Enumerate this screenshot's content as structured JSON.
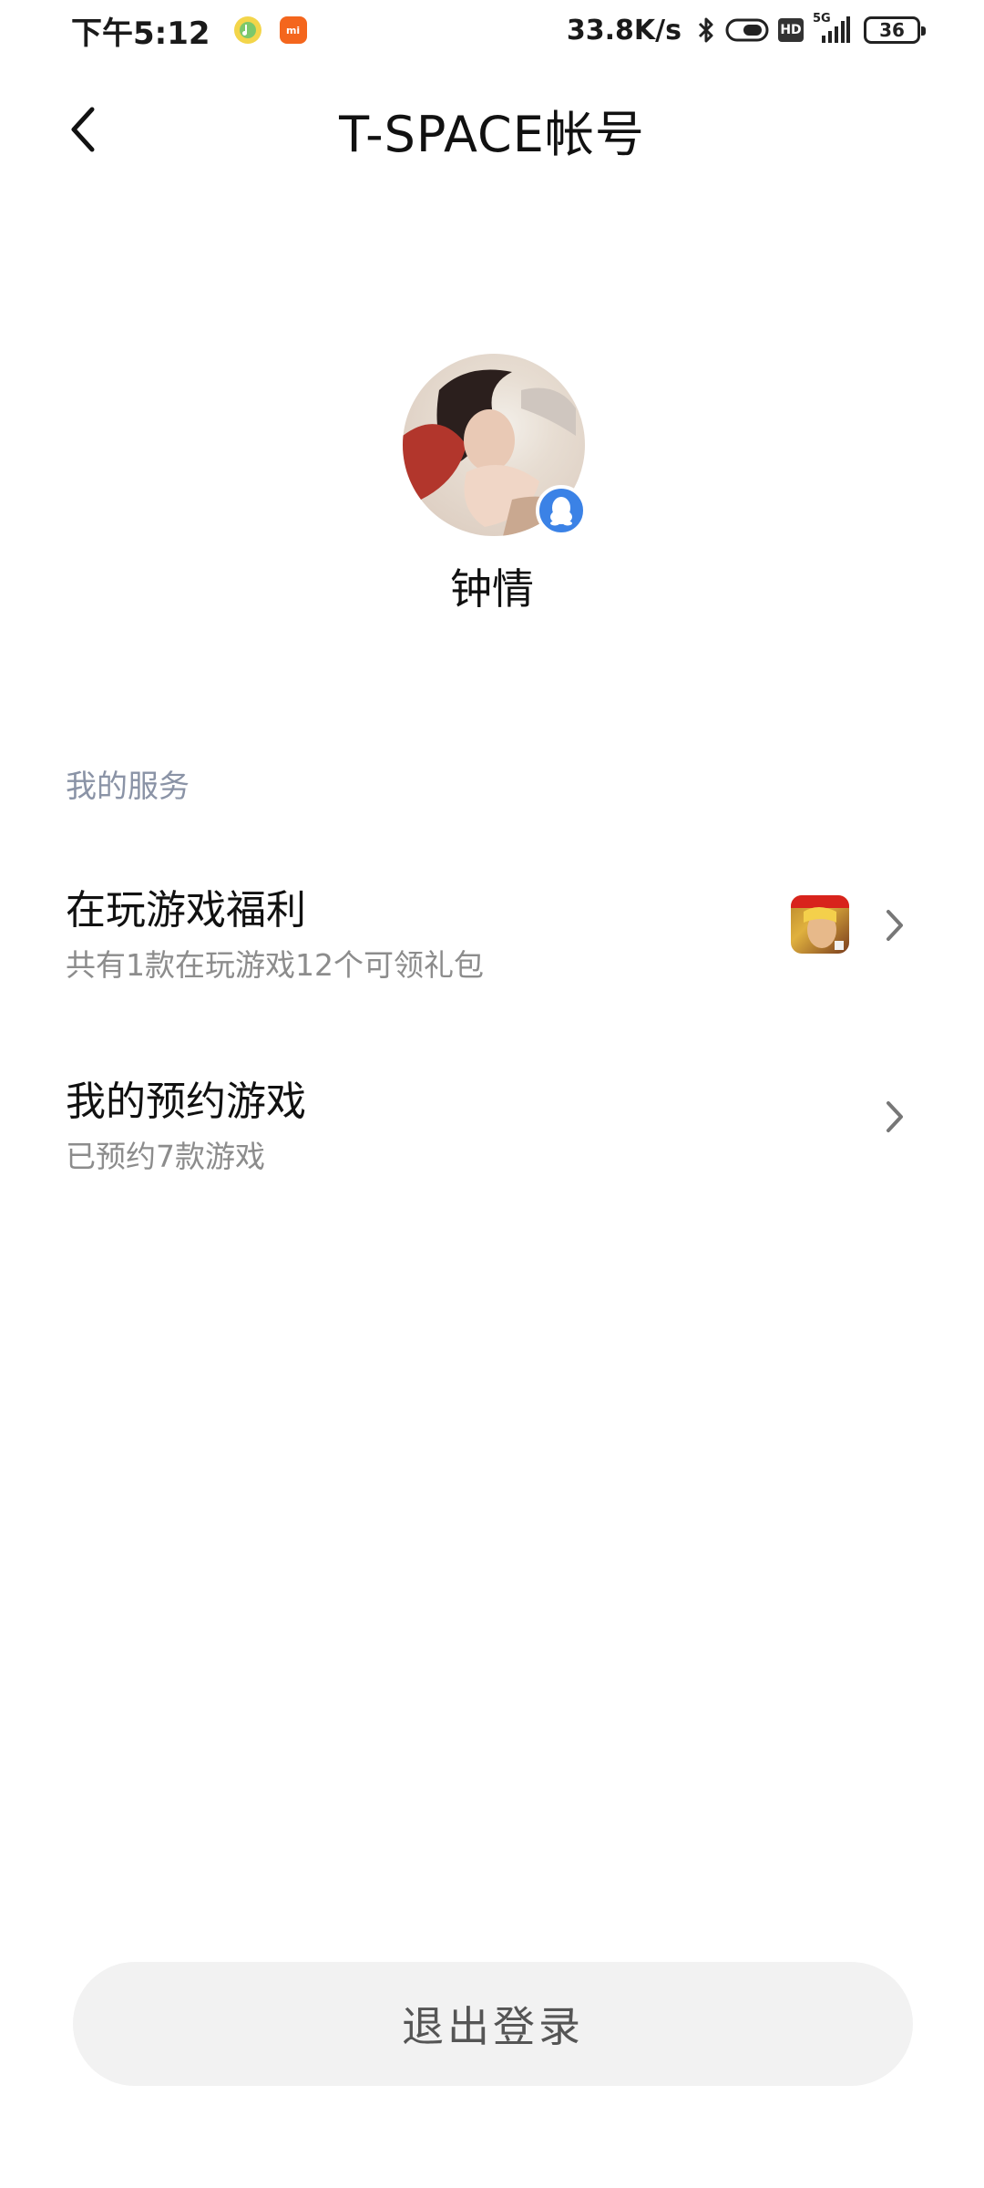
{
  "status_bar": {
    "time": "下午5:12",
    "net_speed": "33.8K/s",
    "network_label": "5G",
    "hd_label": "HD",
    "battery": "36",
    "app_icon_mi_label": "mi"
  },
  "header": {
    "title": "T-SPACE帐号"
  },
  "profile": {
    "username": "钟情"
  },
  "services": {
    "section_title": "我的服务",
    "items": [
      {
        "title": "在玩游戏福利",
        "subtitle": "共有1款在玩游戏12个可领礼包"
      },
      {
        "title": "我的预约游戏",
        "subtitle": "已预约7款游戏"
      }
    ]
  },
  "logout": {
    "label": "退出登录"
  },
  "colors": {
    "qq_badge": "#3b82e6",
    "section_title": "#8a93a6",
    "subtitle": "#8c8c8c",
    "logout_bg": "#f2f2f2"
  }
}
